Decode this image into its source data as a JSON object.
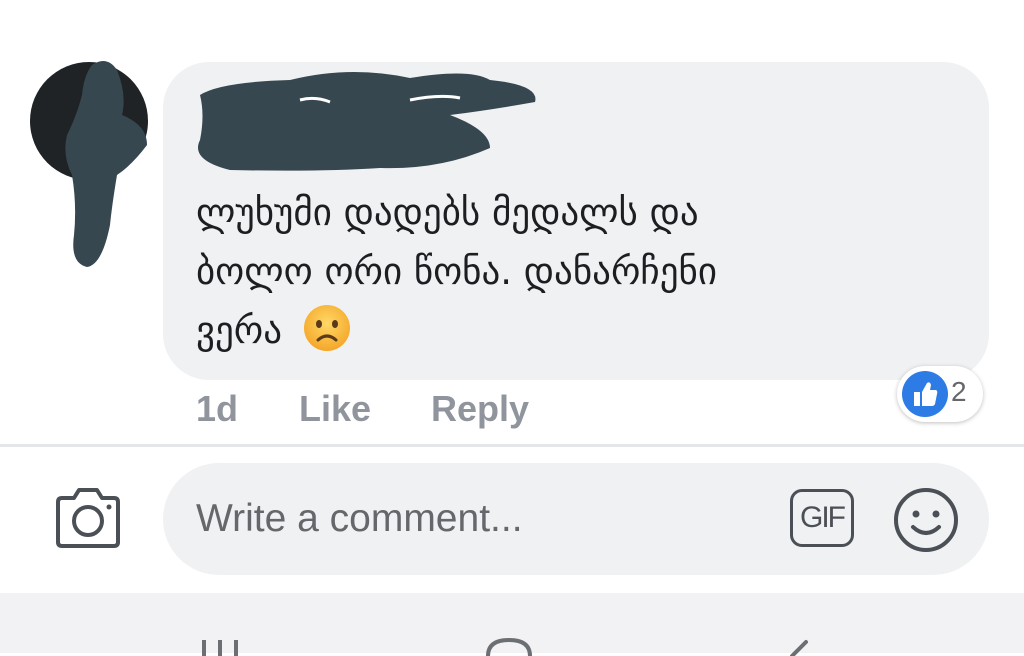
{
  "comment": {
    "text_line1": "ლუხუმი დადებს მედალს და",
    "text_line2": "ბოლო ორი წონა. დანარჩენი",
    "text_line3": "ვერა",
    "emoji": "frowning-face-emoji",
    "time": "1d",
    "like_label": "Like",
    "reply_label": "Reply",
    "reaction_count": "2",
    "reaction_type": "like"
  },
  "composer": {
    "placeholder": "Write a comment...",
    "gif_label": "GIF"
  },
  "colors": {
    "bubble": "#f0f1f3",
    "text": "#1c1e21",
    "meta": "#90949c",
    "like_blue": "#2d7be5",
    "redaction": "#37474f"
  }
}
